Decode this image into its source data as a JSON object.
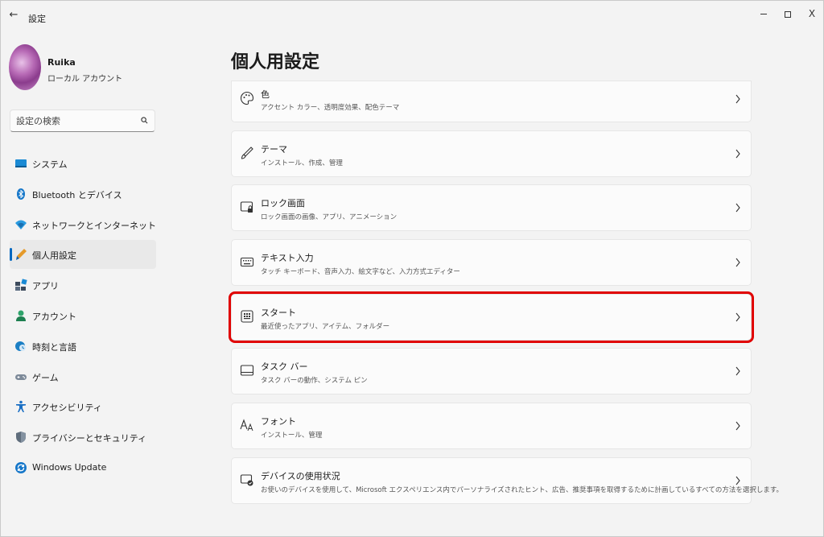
{
  "window": {
    "title": "設定",
    "back_glyph": "←",
    "close_glyph": "X"
  },
  "user": {
    "name": "Ruika",
    "account_type": "ローカル アカウント"
  },
  "search": {
    "placeholder": "設定の検索"
  },
  "sidebar": {
    "items": [
      {
        "label": "システム",
        "icon": "system-icon"
      },
      {
        "label": "Bluetooth とデバイス",
        "icon": "bluetooth-icon"
      },
      {
        "label": "ネットワークとインターネット",
        "icon": "network-icon"
      },
      {
        "label": "個人用設定",
        "icon": "personalization-icon",
        "selected": true
      },
      {
        "label": "アプリ",
        "icon": "apps-icon"
      },
      {
        "label": "アカウント",
        "icon": "account-icon"
      },
      {
        "label": "時刻と言語",
        "icon": "time-language-icon"
      },
      {
        "label": "ゲーム",
        "icon": "gaming-icon"
      },
      {
        "label": "アクセシビリティ",
        "icon": "accessibility-icon"
      },
      {
        "label": "プライバシーとセキュリティ",
        "icon": "privacy-shield-icon"
      },
      {
        "label": "Windows Update",
        "icon": "windows-update-icon"
      }
    ]
  },
  "main": {
    "title": "個人用設定",
    "cards": [
      {
        "title": "色",
        "subtitle": "アクセント カラー、透明度効果、配色テーマ",
        "icon": "palette-icon"
      },
      {
        "title": "テーマ",
        "subtitle": "インストール、作成、管理",
        "icon": "brush-icon"
      },
      {
        "title": "ロック画面",
        "subtitle": "ロック画面の画像、アプリ、アニメーション",
        "icon": "lock-screen-icon"
      },
      {
        "title": "テキスト入力",
        "subtitle": "タッチ キーボード、音声入力、絵文字など、入力方式エディター",
        "icon": "keyboard-icon"
      },
      {
        "title": "スタート",
        "subtitle": "最近使ったアプリ、アイテム、フォルダー",
        "icon": "start-icon",
        "highlighted": true
      },
      {
        "title": "タスク バー",
        "subtitle": "タスク バーの動作、システム ピン",
        "icon": "taskbar-icon"
      },
      {
        "title": "フォント",
        "subtitle": "インストール、管理",
        "icon": "font-icon"
      },
      {
        "title": "デバイスの使用状況",
        "subtitle": "お使いのデバイスを使用して、Microsoft エクスペリエンス内でパーソナライズされたヒント、広告、推奨事項を取得するために計画しているすべての方法を選択します。",
        "icon": "device-usage-icon"
      }
    ]
  },
  "colors": {
    "accent": "#0067c0",
    "highlight_border": "#e00000",
    "background": "#f3f3f3",
    "card": "#fbfbfb"
  }
}
